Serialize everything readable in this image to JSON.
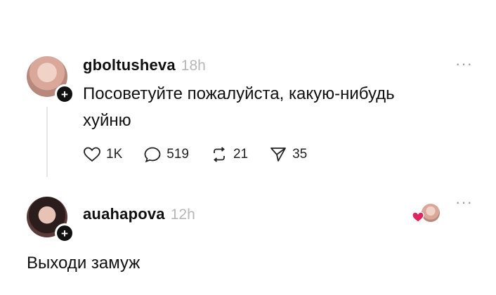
{
  "posts": [
    {
      "username": "gboltusheva",
      "time": "18h",
      "text_line1": "Посоветуйте пожалуйста, какую-нибудь",
      "text_line2": "хуйню",
      "likes": "1K",
      "comments": "519",
      "reposts": "21",
      "shares": "35",
      "more": "···"
    },
    {
      "username": "auahapova",
      "time": "12h",
      "text": "Выходи замуж",
      "more": "···"
    }
  ],
  "colors": {
    "text": "#101010",
    "muted": "#b7b7b7",
    "heart_badge": "#e0245e"
  },
  "icons": [
    "plus-icon",
    "heart-icon",
    "comment-icon",
    "repost-icon",
    "share-icon",
    "more-icon",
    "liked-by-author-icon"
  ]
}
